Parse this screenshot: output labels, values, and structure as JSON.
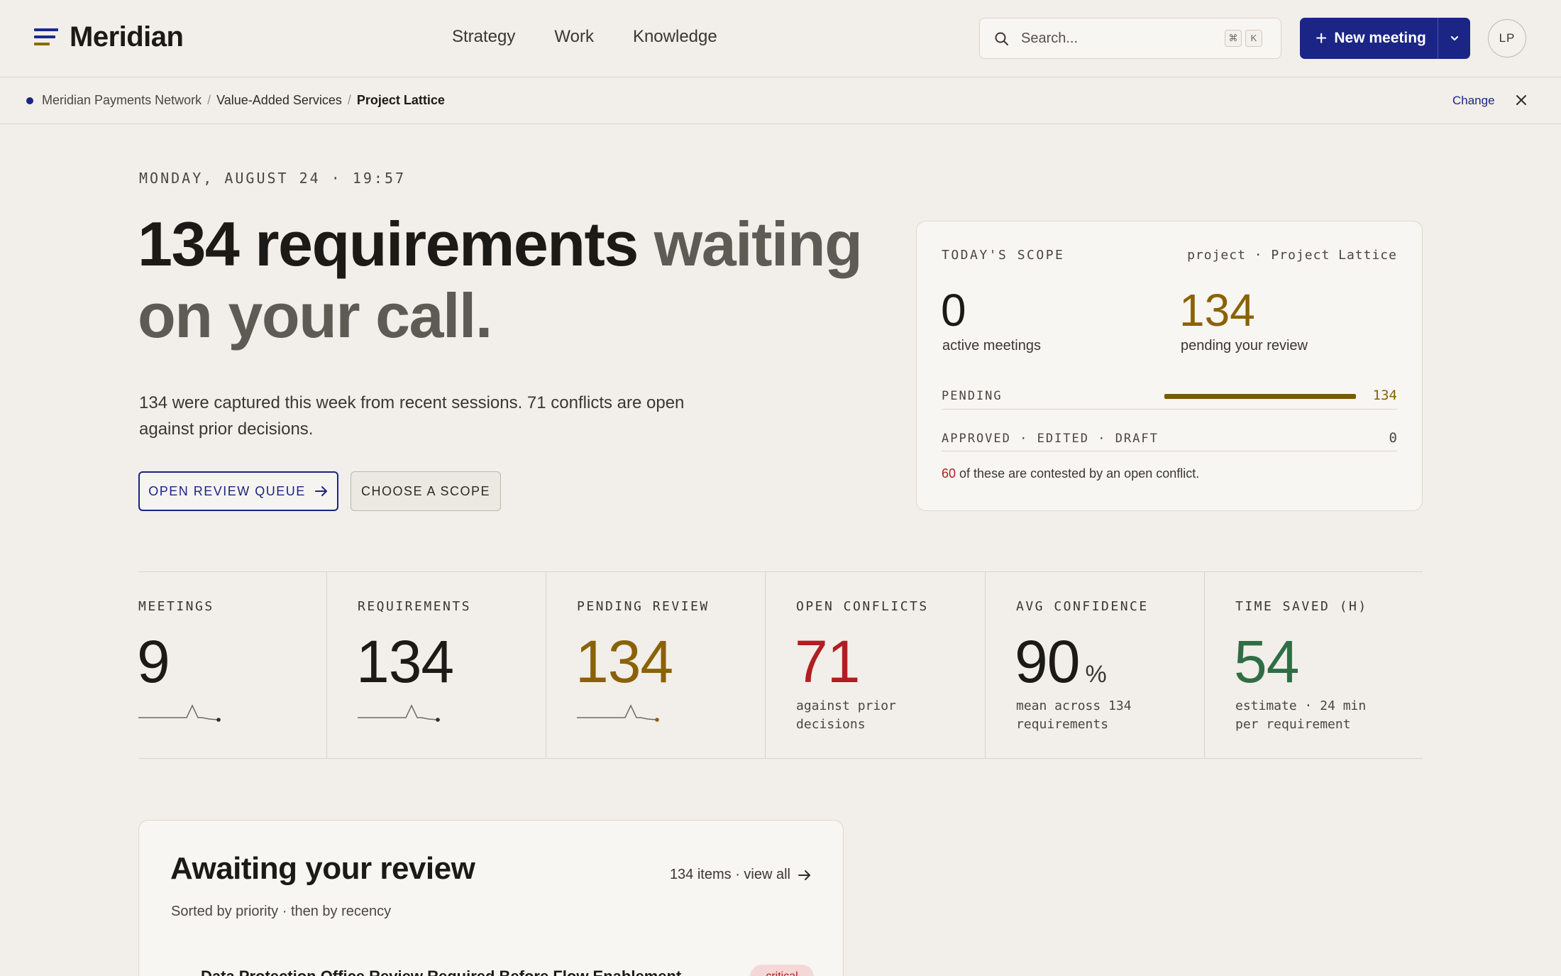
{
  "app": {
    "name": "Meridian"
  },
  "nav": [
    "Strategy",
    "Work",
    "Knowledge"
  ],
  "search": {
    "placeholder": "Search...",
    "shortcut": [
      "⌘",
      "K"
    ]
  },
  "new_meeting": {
    "label": "New meeting"
  },
  "user": {
    "initials": "LP"
  },
  "breadcrumb": {
    "items": [
      "Meridian Payments Network",
      "Value-Added Services",
      "Project Lattice"
    ],
    "change_label": "Change"
  },
  "hero": {
    "dateline": "MONDAY, AUGUST 24 · 19:57",
    "headline_strong": "134 requirements",
    "headline_soft": " waiting on your call.",
    "subtext": "134 were captured this week from recent sessions. 71 conflicts are open against prior decisions.",
    "primary_button": "OPEN REVIEW QUEUE",
    "secondary_button": "CHOOSE A SCOPE"
  },
  "scope": {
    "label": "TODAY'S SCOPE",
    "project": "project · Project Lattice",
    "active_meetings": "0",
    "active_meetings_label": "active meetings",
    "pending": "134",
    "pending_label": "pending your review",
    "row_pending_label": "PENDING",
    "row_pending_value": "134",
    "row_other_label": "APPROVED · EDITED · DRAFT",
    "row_other_value": "0",
    "note_count": "60",
    "note_text": " of these are contested by an open conflict.",
    "colors": {
      "pending": "#8a6205",
      "conflict": "#b01e23"
    }
  },
  "stats": [
    {
      "label": "MEETINGS",
      "value": "9"
    },
    {
      "label": "REQUIREMENTS",
      "value": "134"
    },
    {
      "label": "PENDING REVIEW",
      "value": "134"
    },
    {
      "label": "OPEN CONFLICTS",
      "value": "71",
      "desc_line1": "against prior",
      "desc_line2": "decisions"
    },
    {
      "label": "AVG CONFIDENCE",
      "value": "90",
      "unit": "%",
      "desc_line1": "mean across 134",
      "desc_line2": "requirements"
    },
    {
      "label": "TIME SAVED (H)",
      "value": "54",
      "desc_line1": "estimate · 24 min",
      "desc_line2": "per requirement"
    }
  ],
  "review": {
    "title": "Awaiting your review",
    "subtitle": "Sorted by priority · then by recency",
    "view_all": "134 items · view all",
    "first_item": "Data Protection Office Review Required Before Flow Enablement",
    "first_badge": "critical"
  },
  "icons": [
    "search-icon",
    "chevron-down-icon",
    "close-icon",
    "arrow-right-icon",
    "plus-icon",
    "sparkline"
  ]
}
